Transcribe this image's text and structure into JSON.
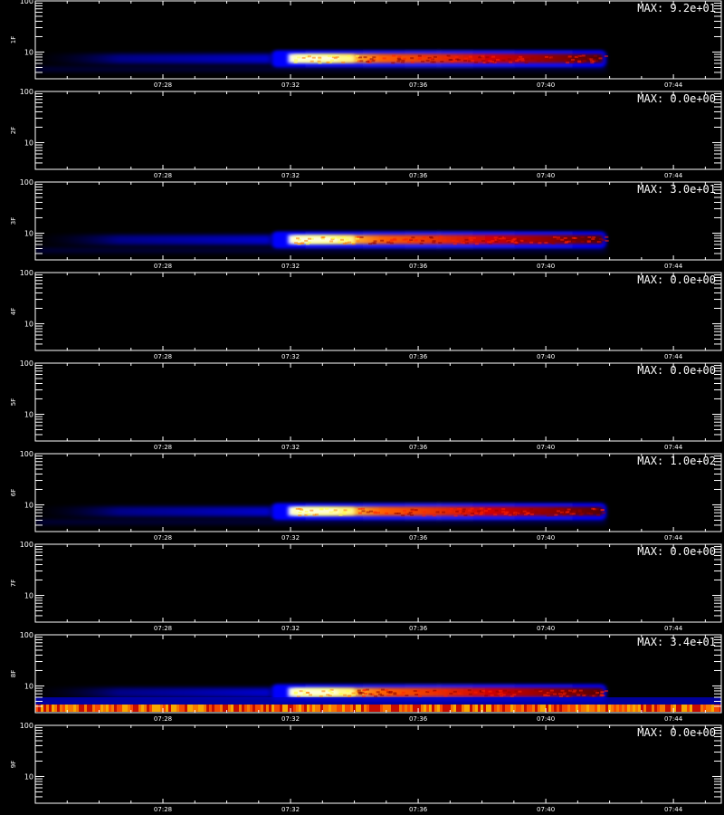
{
  "chart_data": {
    "type": "heatmap",
    "colormap": [
      "#000000",
      "#0000ff",
      "#ff0000",
      "#ffff00",
      "#ffffff"
    ],
    "x_ticks": [
      "07:28",
      "07:32",
      "07:36",
      "07:40",
      "07:44"
    ],
    "x_tick_minutes": [
      28,
      32,
      36,
      40,
      44
    ],
    "x_range_minutes": [
      24,
      45.5
    ],
    "y_ticks": [
      "100",
      "10"
    ],
    "y_ticks_values": [
      100,
      10
    ],
    "y_scale": "log",
    "y_range": [
      3,
      100
    ],
    "panels": [
      {
        "label": "1F",
        "max_label": "MAX: 9.2e+01",
        "max": 92,
        "active": true
      },
      {
        "label": "2F",
        "max_label": "MAX: 0.0e+00",
        "max": 0,
        "active": false
      },
      {
        "label": "3F",
        "max_label": "MAX: 3.0e+01",
        "max": 30,
        "active": true
      },
      {
        "label": "4F",
        "max_label": "MAX: 0.0e+00",
        "max": 0,
        "active": false
      },
      {
        "label": "5F",
        "max_label": "MAX: 0.0e+00",
        "max": 0,
        "active": false
      },
      {
        "label": "6F",
        "max_label": "MAX: 1.0e+02",
        "max": 100,
        "active": true
      },
      {
        "label": "7F",
        "max_label": "MAX: 0.0e+00",
        "max": 0,
        "active": false
      },
      {
        "label": "8F",
        "max_label": "MAX: 3.4e+01",
        "max": 34,
        "active": true,
        "low_energy_band": true
      },
      {
        "label": "9F",
        "max_label": "MAX: 0.0e+00",
        "max": 0,
        "active": false
      }
    ],
    "event": {
      "start_minute": 31.4,
      "peak_start_minute": 32.1,
      "bright_end_minute": 34.0,
      "end_minute": 41.9,
      "center_y": 7.5
    }
  }
}
